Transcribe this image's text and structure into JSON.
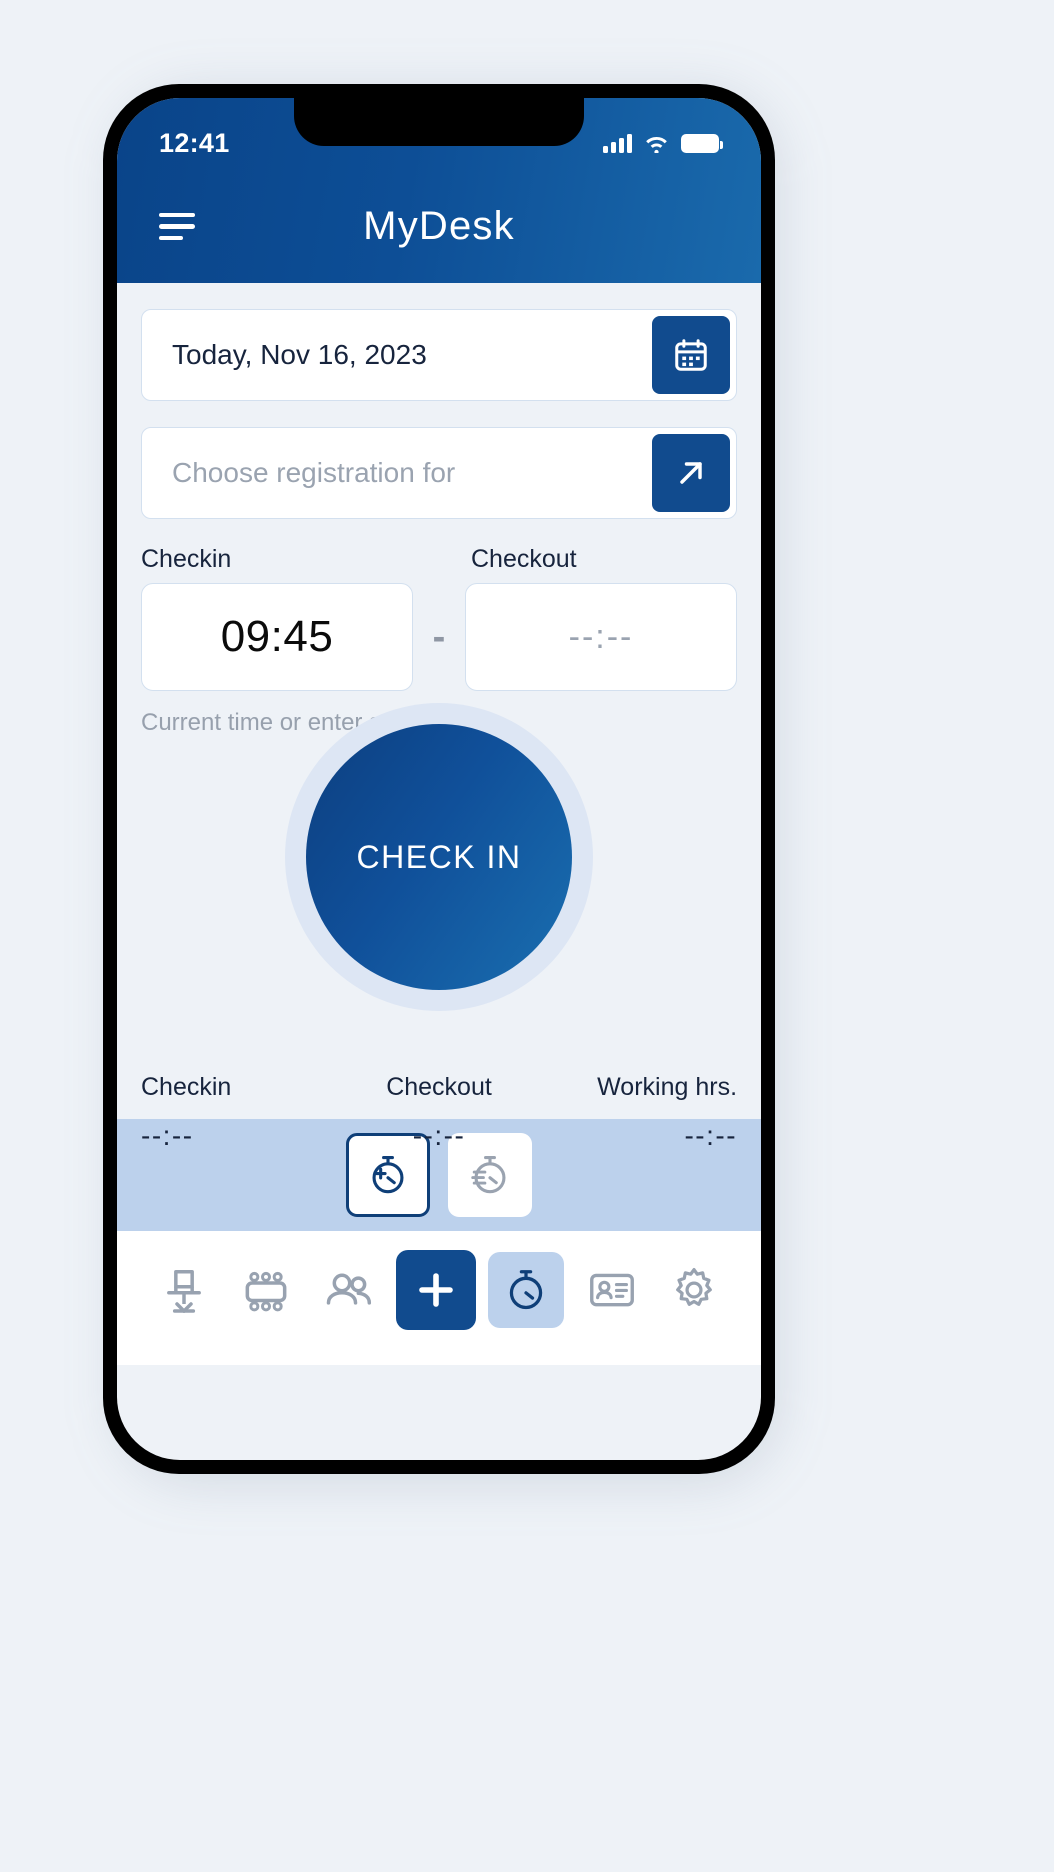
{
  "status_bar": {
    "time": "12:41",
    "signal_icon": "signal-bars-icon",
    "wifi_icon": "wifi-icon",
    "battery_icon": "battery-full-icon"
  },
  "header": {
    "menu_icon": "hamburger-menu-icon",
    "brand": "MyDesk"
  },
  "date_field": {
    "value": "Today, Nov 16, 2023",
    "button_icon": "calendar-icon"
  },
  "registration_field": {
    "placeholder": "Choose registration for",
    "button_icon": "arrow-up-right-icon"
  },
  "time_entry": {
    "checkin_label": "Checkin",
    "checkout_label": "Checkout",
    "checkin_value": "09:45",
    "checkout_value": "--:--",
    "separator": "-",
    "helper": "Current time or enter specific time"
  },
  "action": {
    "check_in_label": "CHECK IN"
  },
  "summary": {
    "columns": [
      {
        "label": "Checkin",
        "value": "--:--"
      },
      {
        "label": "Checkout",
        "value": "--:--"
      },
      {
        "label": "Working hrs.",
        "value": "--:--"
      }
    ]
  },
  "toggle_strip": {
    "items": [
      {
        "icon": "stopwatch-plus-icon",
        "active": true
      },
      {
        "icon": "stopwatch-lines-icon",
        "active": false
      }
    ]
  },
  "bottom_nav": {
    "items": [
      {
        "icon": "office-chair-icon",
        "active": false
      },
      {
        "icon": "meeting-room-icon",
        "active": false
      },
      {
        "icon": "people-icon",
        "active": false
      },
      {
        "icon": "plus-icon",
        "active": false
      },
      {
        "icon": "stopwatch-icon",
        "active": true
      },
      {
        "icon": "id-badge-icon",
        "active": false
      },
      {
        "icon": "gear-icon",
        "active": false
      }
    ]
  },
  "colors": {
    "brand_dark": "#0a4489",
    "brand_mid": "#114b8e",
    "brand_light": "#1a6fb0",
    "page_bg": "#eef2f7",
    "strip_bg": "#bcd1ec",
    "ring": "#dde6f4",
    "text_dark": "#17243d",
    "text_muted": "#97a0ad"
  }
}
